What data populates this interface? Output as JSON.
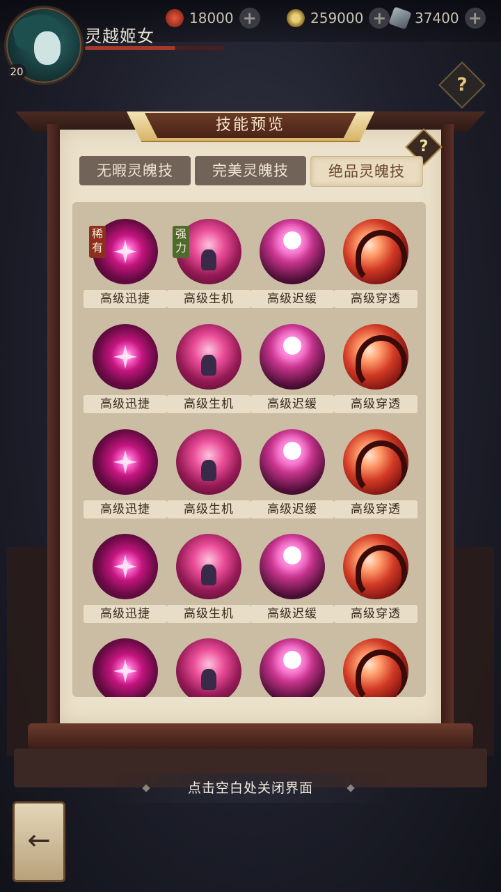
{
  "player": {
    "name": "灵越姬女",
    "level": "20"
  },
  "resources": [
    {
      "icon": "swirl-red-icon",
      "value": "18000",
      "color": "#b7342a"
    },
    {
      "icon": "coin-icon",
      "value": "259000",
      "color": "#c9a24a"
    },
    {
      "icon": "fan-icon",
      "value": "37400",
      "color": "#7d8b96"
    }
  ],
  "panel": {
    "title": "技能预览",
    "help": "?"
  },
  "tabs": [
    {
      "label": "无暇灵魄技",
      "active": false
    },
    {
      "label": "完美灵魄技",
      "active": false
    },
    {
      "label": "绝品灵魄技",
      "active": true
    }
  ],
  "skills": {
    "r0": [
      "高级迅捷",
      "高级生机",
      "高级迟缓",
      "高级穿透"
    ],
    "r1": [
      "高级迅捷",
      "高级生机",
      "高级迟缓",
      "高级穿透"
    ],
    "r2": [
      "高级迅捷",
      "高级生机",
      "高级迟缓",
      "高级穿透"
    ],
    "r3": [
      "高级迅捷",
      "高级生机",
      "高级迟缓",
      "高级穿透"
    ]
  },
  "tags": {
    "rare": "稀有",
    "strong": "强力"
  },
  "footer": {
    "hint": "点击空白处关闭界面"
  },
  "colors": {
    "accent": "#d8b46a",
    "panel": "#ece2cc",
    "frame": "#4b2b22"
  }
}
